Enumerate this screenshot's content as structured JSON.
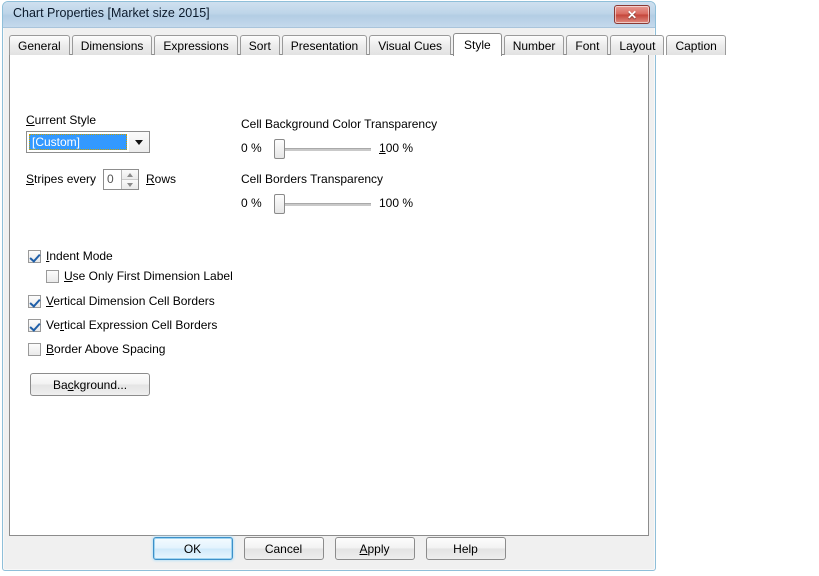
{
  "window": {
    "title": "Chart Properties [Market size 2015]",
    "close_glyph": "✕"
  },
  "tabs": [
    {
      "label": "General",
      "active": false
    },
    {
      "label": "Dimensions",
      "active": false
    },
    {
      "label": "Expressions",
      "active": false
    },
    {
      "label": "Sort",
      "active": false
    },
    {
      "label": "Presentation",
      "active": false
    },
    {
      "label": "Visual Cues",
      "active": false
    },
    {
      "label": "Style",
      "active": true
    },
    {
      "label": "Number",
      "active": false
    },
    {
      "label": "Font",
      "active": false
    },
    {
      "label": "Layout",
      "active": false
    },
    {
      "label": "Caption",
      "active": false
    }
  ],
  "style_tab": {
    "current_style": {
      "label": "Current Style",
      "value": "[Custom]"
    },
    "stripes": {
      "label": "Stripes every",
      "value": "0",
      "units_label": "Rows"
    },
    "sliders": [
      {
        "title": "Cell Background Color Transparency",
        "min_label": "0 %",
        "max_label": "100 %",
        "value": 0
      },
      {
        "title": "Cell Borders Transparency",
        "min_label": "0 %",
        "max_label": "100 %",
        "value": 0
      }
    ],
    "checkboxes": [
      {
        "label": "Indent Mode",
        "checked": true,
        "indented": false
      },
      {
        "label": "Use Only First Dimension Label",
        "checked": false,
        "indented": true
      },
      {
        "label": "Vertical Dimension Cell Borders",
        "checked": true,
        "indented": false
      },
      {
        "label": "Vertical Expression Cell Borders",
        "checked": true,
        "indented": false
      },
      {
        "label": "Border Above Spacing",
        "checked": false,
        "indented": false
      }
    ],
    "background_button": "Background..."
  },
  "footer_buttons": [
    {
      "label": "OK",
      "default": true
    },
    {
      "label": "Cancel",
      "default": false
    },
    {
      "label": "Apply",
      "default": false
    },
    {
      "label": "Help",
      "default": false
    }
  ],
  "colors": {
    "title_bar": "#bed5e9",
    "accent_selection": "#3399ff",
    "close_button": "#c4453a",
    "panel_bg": "#ffffff",
    "dialog_bg": "#f0f0f0"
  }
}
